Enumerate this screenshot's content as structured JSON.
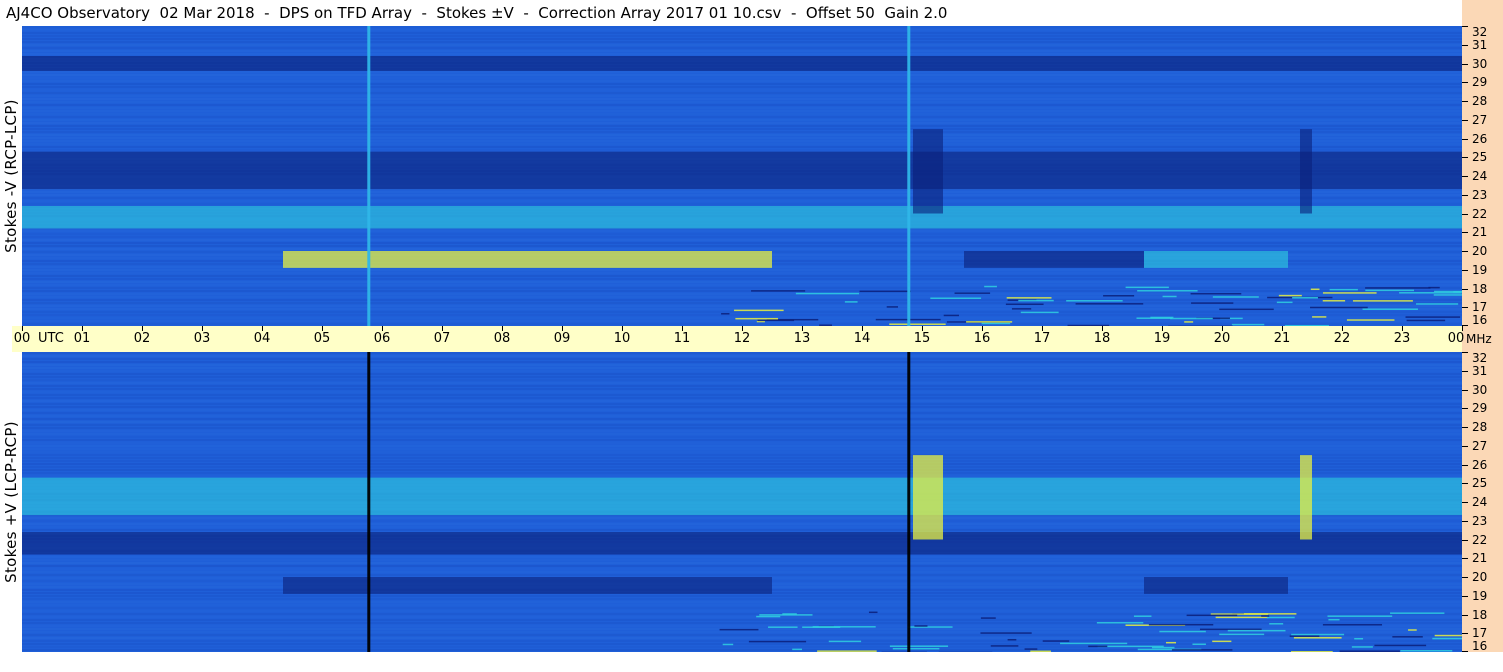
{
  "title": "AJ4CO Observatory  02 Mar 2018  -  DPS on TFD Array  -  Stokes ±V  -  Correction Array 2017 01 10.csv  -  Offset 50  Gain 2.0",
  "colors": {
    "panel_base": "#1f5fd8",
    "scale_bg": "#fbd8b6",
    "time_axis_bg": "#ffffc8",
    "dark_band": "#0a1f7a",
    "bright_band": "#2fd0e0",
    "hot": "#e8f040"
  },
  "chart_data": [
    {
      "type": "heatmap",
      "name": "Stokes -V (RCP-LCP)",
      "ylabel": "Stokes -V (RCP-LCP)",
      "x_ticks": [
        "00",
        "01",
        "02",
        "03",
        "04",
        "05",
        "06",
        "07",
        "08",
        "09",
        "10",
        "11",
        "12",
        "13",
        "14",
        "15",
        "16",
        "17",
        "18",
        "19",
        "20",
        "21",
        "22",
        "23",
        "00"
      ],
      "x_unit": "UTC",
      "x_range_hours": [
        0,
        24
      ],
      "y_ticks": [
        32,
        31,
        30,
        29,
        28,
        27,
        26,
        25,
        24,
        23,
        22,
        21,
        20,
        19,
        18,
        17,
        16
      ],
      "y_unit": "MHz",
      "y_range_mhz": [
        16,
        32
      ],
      "bands": [
        {
          "f1": 29.6,
          "f2": 30.4,
          "t1": 0,
          "t2": 24,
          "level": "dark"
        },
        {
          "f1": 23.3,
          "f2": 25.3,
          "t1": 0,
          "t2": 24,
          "level": "dark"
        },
        {
          "f1": 21.2,
          "f2": 22.4,
          "t1": 0,
          "t2": 24,
          "level": "bright"
        },
        {
          "f1": 19.1,
          "f2": 20.0,
          "t1": 4.35,
          "t2": 12.5,
          "level": "hot"
        },
        {
          "f1": 19.1,
          "f2": 20.0,
          "t1": 15.7,
          "t2": 18.7,
          "level": "dark"
        },
        {
          "f1": 19.1,
          "f2": 20.0,
          "t1": 18.7,
          "t2": 21.1,
          "level": "bright"
        },
        {
          "f1": 22.0,
          "f2": 26.5,
          "t1": 21.3,
          "t2": 21.5,
          "level": "dark"
        },
        {
          "f1": 22.0,
          "f2": 26.5,
          "t1": 14.85,
          "t2": 15.35,
          "level": "dark"
        },
        {
          "f1": 16.0,
          "f2": 18.2,
          "t1": 11.6,
          "t2": 24,
          "level": "noise"
        }
      ],
      "events_utc": [
        5.78,
        14.78
      ]
    },
    {
      "type": "heatmap",
      "name": "Stokes +V (LCP-RCP)",
      "ylabel": "Stokes +V (LCP-RCP)",
      "x_ticks": [
        "00",
        "01",
        "02",
        "03",
        "04",
        "05",
        "06",
        "07",
        "08",
        "09",
        "10",
        "11",
        "12",
        "13",
        "14",
        "15",
        "16",
        "17",
        "18",
        "19",
        "20",
        "21",
        "22",
        "23",
        "00"
      ],
      "x_unit": "UTC",
      "x_range_hours": [
        0,
        24
      ],
      "y_ticks": [
        32,
        31,
        30,
        29,
        28,
        27,
        26,
        25,
        24,
        23,
        22,
        21,
        20,
        19,
        18,
        17,
        16
      ],
      "y_unit": "MHz",
      "y_range_mhz": [
        16,
        32
      ],
      "bands": [
        {
          "f1": 23.3,
          "f2": 25.3,
          "t1": 0,
          "t2": 24,
          "level": "bright"
        },
        {
          "f1": 21.2,
          "f2": 22.4,
          "t1": 0,
          "t2": 24,
          "level": "dark"
        },
        {
          "f1": 19.1,
          "f2": 20.0,
          "t1": 4.35,
          "t2": 12.5,
          "level": "dark"
        },
        {
          "f1": 19.1,
          "f2": 20.0,
          "t1": 18.7,
          "t2": 21.1,
          "level": "dark"
        },
        {
          "f1": 22.0,
          "f2": 26.5,
          "t1": 21.3,
          "t2": 21.5,
          "level": "hot"
        },
        {
          "f1": 22.0,
          "f2": 26.5,
          "t1": 14.85,
          "t2": 15.35,
          "level": "hot"
        },
        {
          "f1": 16.0,
          "f2": 18.2,
          "t1": 11.6,
          "t2": 24,
          "level": "noise"
        }
      ],
      "events_utc": [
        5.78,
        14.78
      ]
    }
  ],
  "axis": {
    "utc_word": "UTC",
    "mhz_unit": "MHz"
  }
}
